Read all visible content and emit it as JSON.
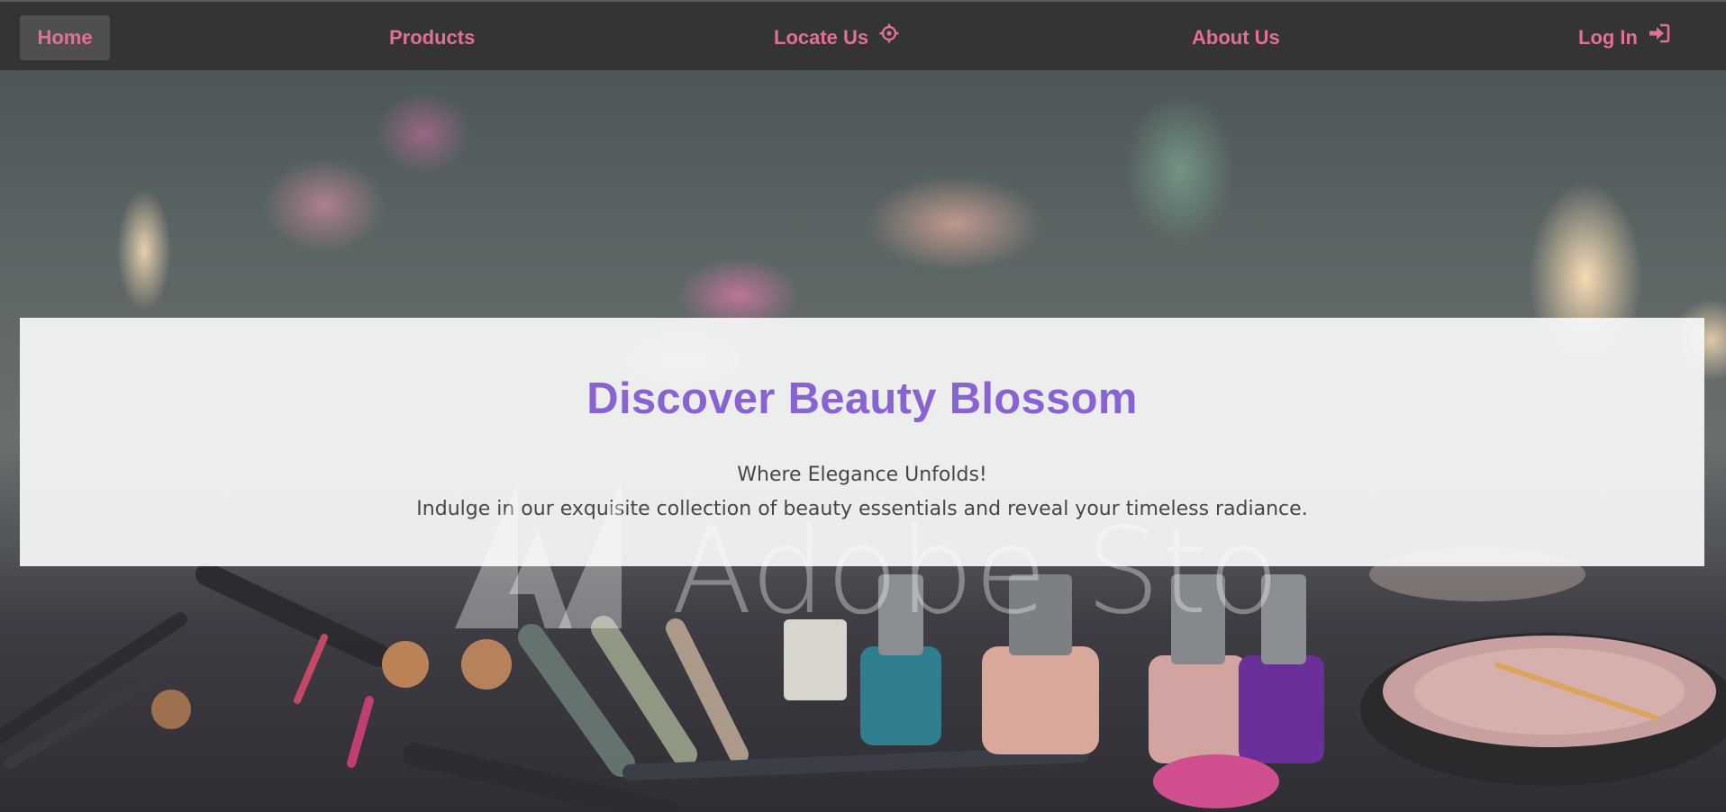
{
  "nav": {
    "home_label": "Home",
    "products_label": "Products",
    "locate_label": "Locate Us",
    "about_label": "About Us",
    "login_label": "Log In",
    "accent_color": "#e0709a",
    "active_bg": "#4f4f4f",
    "locate_icon": "crosshair-icon",
    "login_icon": "sign-in-icon"
  },
  "hero": {
    "title": "Discover Beauty Blossom",
    "tagline": "Where Elegance Unfolds!",
    "description": "Indulge in our exquisite collection of beauty essentials and reveal your timeless radiance.",
    "title_color": "#8a63d2"
  },
  "watermark": {
    "text": "Adobe Stock"
  }
}
